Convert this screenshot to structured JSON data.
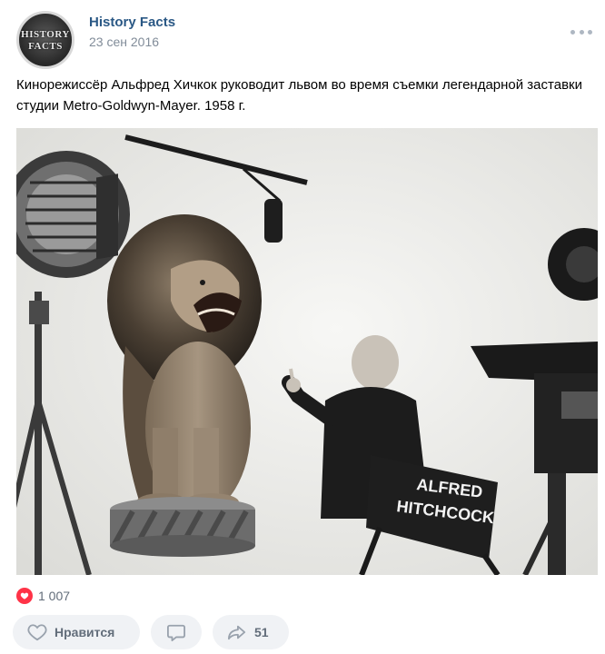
{
  "post": {
    "community": {
      "name": "History Facts",
      "avatar_text_line1": "HISTORY",
      "avatar_text_line2": "FACTS"
    },
    "date": "23 сен 2016",
    "text": "Кинорежиссёр Альфред Хичкок руководит львом во время съемки легендарной заставки студии Metro-Goldwyn-Mayer. 1958 г.",
    "photo": {
      "chair_text_line1": "ALFRED",
      "chair_text_line2": "HITCHCOCK"
    },
    "reactions": {
      "count": "1 007",
      "icon": "heart-icon",
      "color": "#ff3347"
    },
    "actions": {
      "like_label": "Нравится",
      "share_count": "51"
    }
  },
  "colors": {
    "link": "#2a5885",
    "secondary": "#818c99",
    "button_bg": "#f0f2f5",
    "button_text": "#626d7a"
  }
}
